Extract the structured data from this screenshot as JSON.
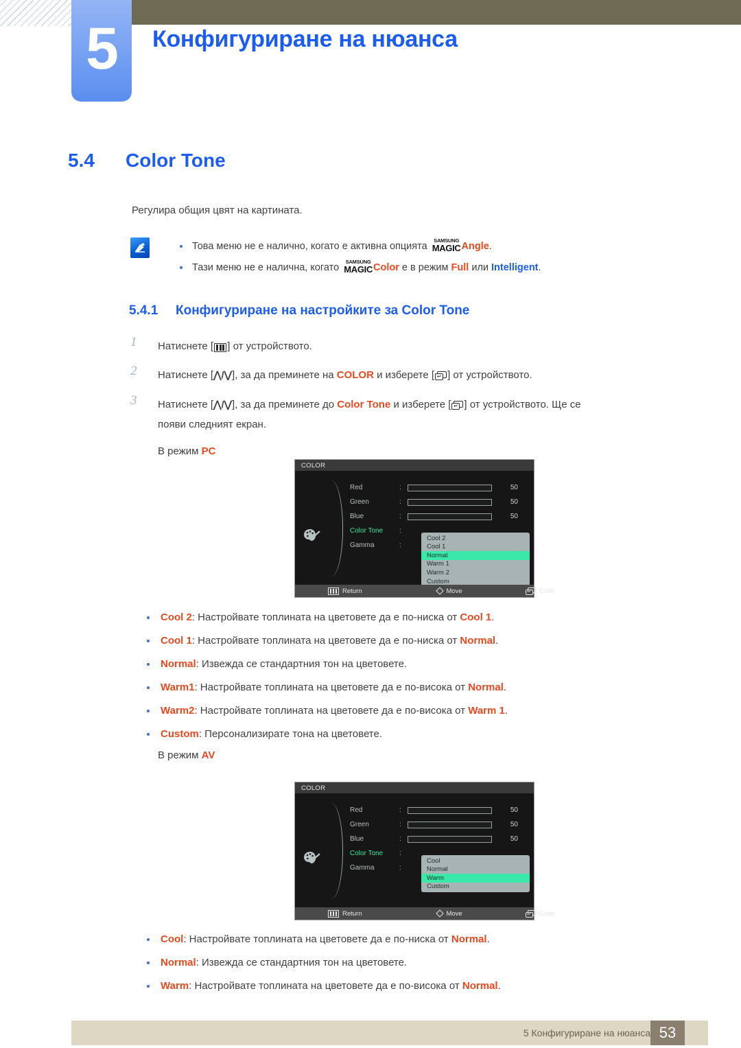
{
  "header": {
    "chapter_number": "5",
    "chapter_title": "Конфигуриране на нюанса"
  },
  "section": {
    "number": "5.4",
    "title": "Color Tone",
    "intro": "Регулира общия цвят на картината."
  },
  "notes": {
    "icon": "note-pen-icon",
    "items": [
      {
        "pre": "Това меню не е налично, когато е активна опцията ",
        "brand_top": "SAMSUNG",
        "brand_bottom": "MAGIC",
        "highlight": "Angle",
        "post": "."
      },
      {
        "pre": "Тази меню не е налична, когато ",
        "brand_top": "SAMSUNG",
        "brand_bottom": "MAGIC",
        "highlight": "Color",
        "mid": " е в режим ",
        "opt1": "Full",
        "conj": " или ",
        "opt2": "Intelligent",
        "post": "."
      }
    ]
  },
  "subsection": {
    "number": "5.4.1",
    "title": "Конфигуриране на настройките за Color Tone"
  },
  "steps": [
    {
      "n": "1",
      "parts": [
        "Натиснете [",
        "MENU_ICON",
        "] от устройството."
      ]
    },
    {
      "n": "2",
      "a": "Натиснете [",
      "updn": "⋀/⋁",
      "b": "], за да преминете на ",
      "hl": "COLOR",
      "c": " и изберете [",
      "d": "] от устройството."
    },
    {
      "n": "3",
      "a": "Натиснете [",
      "updn": "⋀/⋁",
      "b": "], за да преминете до ",
      "hl": "Color Tone",
      "c": " и изберете [",
      "d": "] от устройството. Ще се",
      "line2": "появи следният екран."
    }
  ],
  "mode_pc": {
    "prefix": "В режим ",
    "label": "PC"
  },
  "mode_av": {
    "prefix": "В режим ",
    "label": "AV"
  },
  "osd_pc": {
    "title": "COLOR",
    "icon": "palette-icon",
    "rows": [
      {
        "label": "Red",
        "colon": ":",
        "value": "50",
        "bar": 50,
        "type": "slider"
      },
      {
        "label": "Green",
        "colon": ":",
        "value": "50",
        "bar": 50,
        "type": "slider"
      },
      {
        "label": "Blue",
        "colon": ":",
        "value": "50",
        "bar": 50,
        "type": "slider"
      },
      {
        "label": "Color Tone",
        "colon": ":",
        "value": "",
        "type": "selected"
      },
      {
        "label": "Gamma",
        "colon": ":",
        "value": "",
        "type": "plain"
      }
    ],
    "options": [
      "Cool 2",
      "Cool 1",
      "Normal",
      "Warm 1",
      "Warm 2",
      "Custom"
    ],
    "selected_option": "Normal",
    "footer": [
      {
        "icon": "menu-icon",
        "label": "Return"
      },
      {
        "icon": "diamond-icon",
        "label": "Move"
      },
      {
        "icon": "enter-icon",
        "label": "Enter"
      }
    ]
  },
  "osd_av": {
    "title": "COLOR",
    "icon": "palette-icon",
    "rows": [
      {
        "label": "Red",
        "colon": ":",
        "value": "50",
        "bar": 50,
        "type": "slider"
      },
      {
        "label": "Green",
        "colon": ":",
        "value": "50",
        "bar": 50,
        "type": "slider"
      },
      {
        "label": "Blue",
        "colon": ":",
        "value": "50",
        "bar": 50,
        "type": "slider"
      },
      {
        "label": "Color Tone",
        "colon": ":",
        "value": "",
        "type": "selected"
      },
      {
        "label": "Gamma",
        "colon": ":",
        "value": "",
        "type": "plain"
      }
    ],
    "options": [
      "Cool",
      "Normal",
      "Warm",
      "Custom"
    ],
    "selected_option": "Warm",
    "footer": [
      {
        "icon": "menu-icon",
        "label": "Return"
      },
      {
        "icon": "diamond-icon",
        "label": "Move"
      },
      {
        "icon": "enter-icon",
        "label": "Enter"
      }
    ]
  },
  "pc_descriptions": [
    {
      "term": "Cool 2",
      "text": ": Настройвате топлината на цветовете да е по-ниска от ",
      "ref": "Cool 1",
      "end": "."
    },
    {
      "term": "Cool 1",
      "text": ": Настройвате топлината на цветовете да е по-ниска от ",
      "ref": "Normal",
      "end": "."
    },
    {
      "term": "Normal",
      "text": ": Извежда се стандартния тон на цветовете.",
      "ref": "",
      "end": ""
    },
    {
      "term": "Warm1",
      "text": ": Настройвате топлината на цветовете да е по-висока от ",
      "ref": "Normal",
      "end": "."
    },
    {
      "term": "Warm2",
      "text": ": Настройвате топлината на цветовете да е по-висока от ",
      "ref": "Warm 1",
      "end": "."
    },
    {
      "term": "Custom",
      "text": ": Персонализирате тона на цветовете.",
      "ref": "",
      "end": ""
    }
  ],
  "av_descriptions": [
    {
      "term": "Cool",
      "text": ": Настройвате топлината на цветовете да е по-ниска от ",
      "ref": "Normal",
      "end": "."
    },
    {
      "term": "Normal",
      "text": ": Извежда се стандартния тон на цветовете.",
      "ref": "",
      "end": ""
    },
    {
      "term": "Warm",
      "text": ": Настройвате топлината на цветовете да е по-висока от ",
      "ref": "Normal",
      "end": "."
    }
  ],
  "footer": {
    "text": "5 Конфигуриране на нюанса",
    "page": "53"
  },
  "colors": {
    "brand_blue": "#1c5cf0",
    "accent_orange": "#e8491e",
    "olive": "#6e6a54",
    "tab_blue": "#7ba4f2",
    "footer_bg": "#ded7c3",
    "page_badge": "#8b7f70",
    "osd_bg": "#161616",
    "osd_highlight": "#3ae8a9",
    "osd_selected_text": "#2fe6a0"
  }
}
